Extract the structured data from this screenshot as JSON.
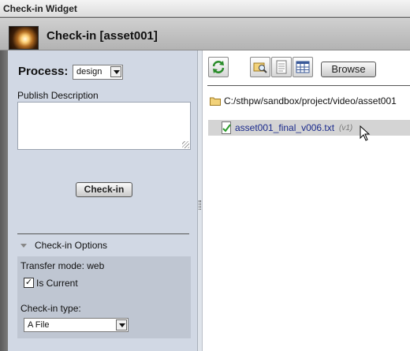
{
  "window": {
    "title": "Check-in Widget"
  },
  "header": {
    "title": "Check-in [asset001]"
  },
  "left": {
    "process_label": "Process:",
    "process_value": "design",
    "publish_label": "Publish Description",
    "publish_value": "",
    "checkin_button": "Check-in",
    "options_header": "Check-in Options",
    "transfer_mode": "Transfer mode: web",
    "is_current_label": "Is Current",
    "is_current_checked": true,
    "checkin_type_label": "Check-in type:",
    "checkin_type_value": "A File"
  },
  "right": {
    "browse_button": "Browse",
    "folder_path": "C:/sthpw/sandbox/project/video/asset001",
    "file_name": "asset001_final_v006.txt",
    "file_version": "(v1)",
    "icons": [
      "refresh-icon",
      "search-icon",
      "document-icon",
      "grid-icon",
      "folder-icon",
      "file-check-icon"
    ]
  },
  "colors": {
    "left_panel_bg": "#d1d8e4",
    "options_bg": "#bfc6d2",
    "file_link": "#1a2a8c",
    "selected_row": "#d4d4d4"
  }
}
